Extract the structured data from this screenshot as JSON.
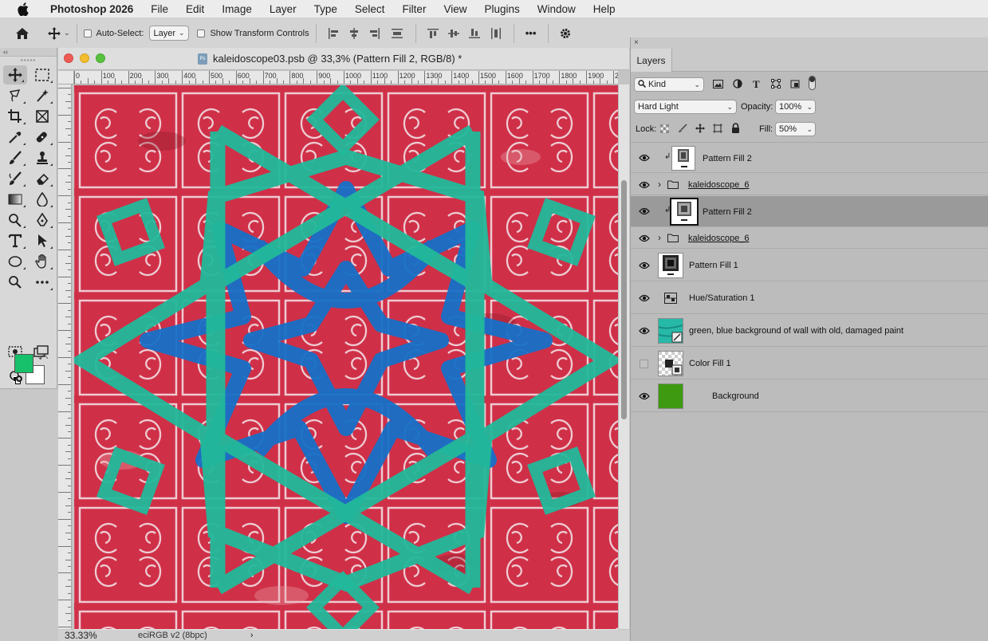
{
  "menubar": {
    "app": "Photoshop 2026",
    "items": [
      "File",
      "Edit",
      "Image",
      "Layer",
      "Type",
      "Select",
      "Filter",
      "View",
      "Plugins",
      "Window",
      "Help"
    ]
  },
  "options": {
    "auto_select_label": "Auto-Select:",
    "auto_select_value": "Layer",
    "transform_label": "Show Transform Controls",
    "more": "•••"
  },
  "document": {
    "title": "kaleidoscope03.psb @ 33,3% (Pattern Fill 2, RGB/8) *",
    "zoom": "33.33%",
    "profile": "eciRGB v2 (8bpc)",
    "ruler_h": [
      "0",
      "100",
      "200",
      "300",
      "400",
      "500",
      "600",
      "700",
      "800",
      "900",
      "1000",
      "1100",
      "1200",
      "1300",
      "1400",
      "1500",
      "1600",
      "1700",
      "1800",
      "1900",
      "200"
    ]
  },
  "layers_panel": {
    "tab": "Layers",
    "filter_kind": "Kind",
    "blend_mode": "Hard Light",
    "opacity_label": "Opacity:",
    "opacity": "100%",
    "lock_label": "Lock:",
    "fill_label": "Fill:",
    "fill": "50%",
    "layers": [
      {
        "name": "Pattern Fill 2",
        "visible": true,
        "type": "pattern",
        "clipped": true
      },
      {
        "name": "kaleidoscope_6",
        "visible": true,
        "type": "group"
      },
      {
        "name": "Pattern Fill 2",
        "visible": true,
        "type": "pattern",
        "clipped": true,
        "selected": true
      },
      {
        "name": "kaleidoscope_6",
        "visible": true,
        "type": "group"
      },
      {
        "name": "Pattern Fill 1",
        "visible": true,
        "type": "pattern"
      },
      {
        "name": "Hue/Saturation 1",
        "visible": true,
        "type": "adjustment"
      },
      {
        "name": "green, blue background of wall with old, damaged paint",
        "visible": true,
        "type": "image"
      },
      {
        "name": "Color Fill 1",
        "visible": false,
        "type": "fill"
      },
      {
        "name": "Background",
        "visible": true,
        "type": "background"
      }
    ]
  },
  "colors": {
    "foreground": "#17c06a",
    "background": "#ffffff",
    "background_layer": "#3e9a10",
    "canvas_red": "#c8283e",
    "teal": "#20b79a",
    "blue": "#1573c9"
  }
}
